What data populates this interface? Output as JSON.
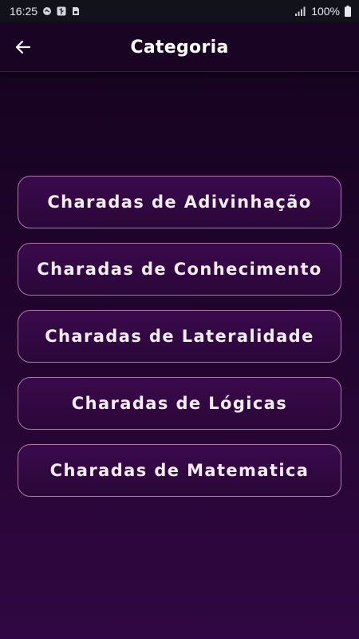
{
  "status_bar": {
    "time": "16:25",
    "battery": "100%",
    "left_icons": [
      "notification-icon",
      "usb-icon",
      "sim-card-icon"
    ],
    "right_icons": [
      "signal-icon",
      "battery-icon"
    ]
  },
  "app_bar": {
    "back_icon": "back-arrow-icon",
    "title": "Categoria"
  },
  "categories": [
    {
      "label": "Charadas de Adivinhação"
    },
    {
      "label": "Charadas de Conhecimento"
    },
    {
      "label": "Charadas de Lateralidade"
    },
    {
      "label": "Charadas de Lógicas"
    },
    {
      "label": "Charadas de Matematica"
    }
  ],
  "colors": {
    "background": "#1d0429",
    "button_fill": "#330942",
    "button_border": "#b07aa8",
    "text": "#f3eef3"
  }
}
